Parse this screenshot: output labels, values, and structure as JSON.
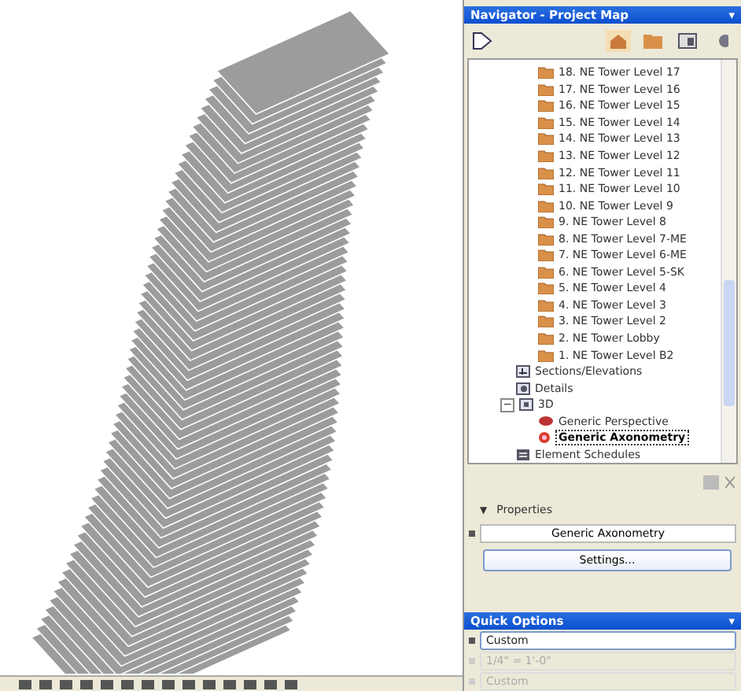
{
  "navigator": {
    "title": "Navigator - Project Map",
    "menu_glyph": "▾"
  },
  "stories": [
    {
      "label": "18. NE Tower Level 17"
    },
    {
      "label": "17. NE Tower Level 16"
    },
    {
      "label": "16. NE Tower Level 15"
    },
    {
      "label": "15. NE Tower Level 14"
    },
    {
      "label": "14. NE Tower Level 13"
    },
    {
      "label": "13. NE Tower Level 12"
    },
    {
      "label": "12. NE Tower Level 11"
    },
    {
      "label": "11. NE Tower Level 10"
    },
    {
      "label": "10. NE Tower Level 9"
    },
    {
      "label": "9. NE Tower Level 8"
    },
    {
      "label": "8. NE Tower Level 7-ME"
    },
    {
      "label": "7. NE Tower Level 6-ME"
    },
    {
      "label": "6. NE Tower Level 5-SK"
    },
    {
      "label": "5. NE Tower Level 4"
    },
    {
      "label": "4. NE Tower Level 3"
    },
    {
      "label": "3. NE Tower Level 2"
    },
    {
      "label": "2. NE Tower Lobby"
    },
    {
      "label": "1. NE Tower Level B2"
    }
  ],
  "nodes": [
    {
      "label": "Sections/Elevations",
      "kind": "sections",
      "selected": false
    },
    {
      "label": "Details",
      "kind": "details",
      "selected": false
    },
    {
      "label": "3D",
      "kind": "folder3d",
      "selected": false,
      "expanded": true,
      "toggle": "−",
      "children": [
        {
          "label": "Generic Perspective",
          "kind": "perspective",
          "selected": false
        },
        {
          "label": "Generic Axonometry",
          "kind": "axonometry",
          "selected": true
        }
      ]
    },
    {
      "label": "Element Schedules",
      "kind": "schedules",
      "selected": false
    }
  ],
  "properties": {
    "heading": "Properties",
    "toggle": "▼",
    "view_name": "Generic Axonometry",
    "button": "Settings..."
  },
  "quick_options": {
    "title": "Quick Options",
    "menu_glyph": "▾",
    "rows": [
      {
        "value": "Custom",
        "enabled": true
      },
      {
        "value": "1/4\"  =  1'-0\"",
        "enabled": false
      },
      {
        "value": "Custom",
        "enabled": false
      }
    ]
  }
}
